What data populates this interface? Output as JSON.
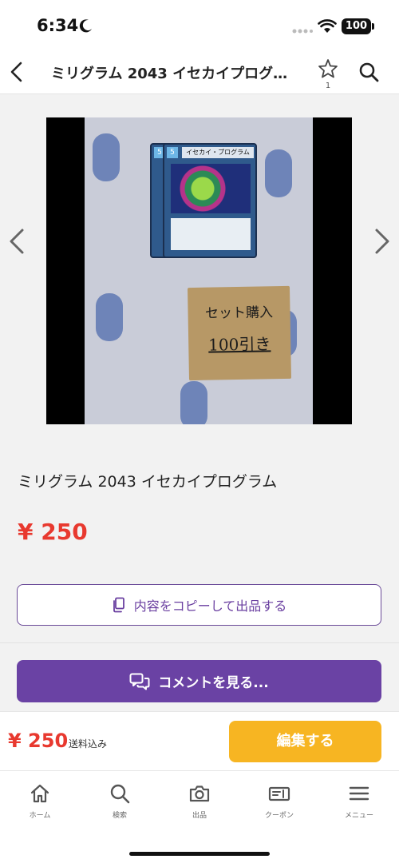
{
  "status_bar": {
    "time": "6:34",
    "battery": "100"
  },
  "header": {
    "title": "ミリグラム 2043 イセカイプログラム",
    "favorite_count": "1"
  },
  "gallery": {
    "card_cost": "5",
    "card_name": "イセカイ・プログラム",
    "note_line1": "セット購入",
    "note_line2": "100引き"
  },
  "item": {
    "title": "ミリグラム 2043 イセカイプログラム",
    "price": "¥ 250"
  },
  "actions": {
    "copy_label": "内容をコピーして出品する",
    "comments_label": "コメントを見る..."
  },
  "purchase_bar": {
    "price": "¥ 250",
    "shipping": "送料込み",
    "edit_label": "編集する"
  },
  "tab_bar": {
    "items": [
      {
        "label": "ホーム",
        "icon": "home-icon"
      },
      {
        "label": "検索",
        "icon": "search-icon"
      },
      {
        "label": "出品",
        "icon": "camera-icon"
      },
      {
        "label": "クーポン",
        "icon": "coupon-icon"
      },
      {
        "label": "メニュー",
        "icon": "menu-icon"
      }
    ]
  },
  "colors": {
    "accent_purple": "#6a42a4",
    "price_red": "#e8392f",
    "edit_yellow": "#f7b522"
  }
}
